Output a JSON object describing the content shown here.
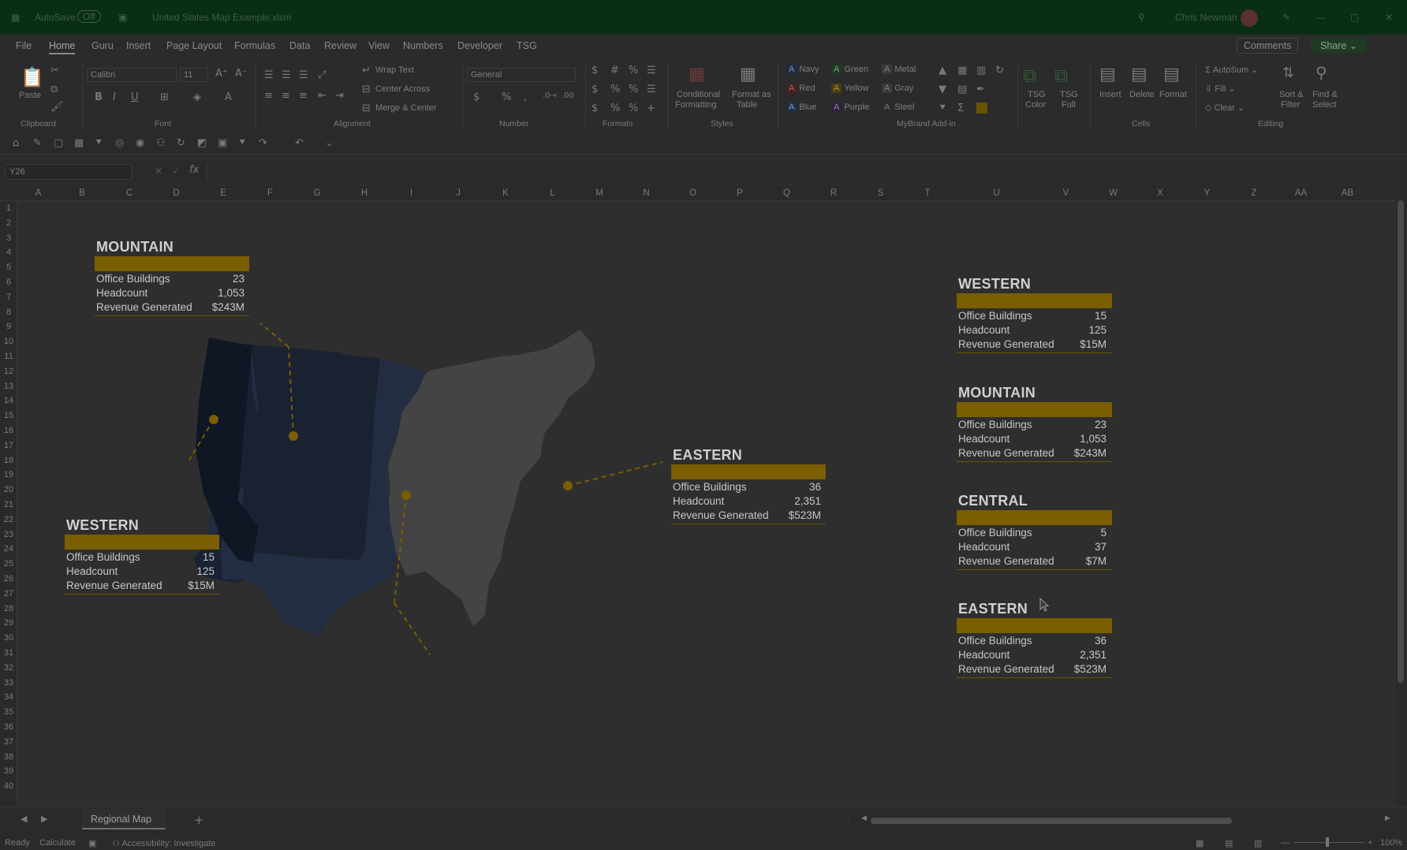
{
  "titlebar": {
    "autosave": "AutoSave",
    "autosave_state": "Off",
    "doc_title": "United States Map Example.xlsm",
    "user": "Chris Newman"
  },
  "menu": [
    "File",
    "Home",
    "Guru",
    "Insert",
    "Page Layout",
    "Formulas",
    "Data",
    "Review",
    "View",
    "Numbers",
    "Developer",
    "TSG"
  ],
  "menu_right": {
    "comments": "Comments",
    "share": "Share"
  },
  "ribbon": {
    "clipboard": {
      "paste": "Paste",
      "group": "Clipboard"
    },
    "font": {
      "name": "Calibri",
      "size": "11",
      "group": "Font"
    },
    "alignment": {
      "wrap": "Wrap Text",
      "center_across": "Center Across",
      "merge": "Merge & Center",
      "group": "Alignment"
    },
    "number": {
      "format": "General",
      "group": "Number"
    },
    "formats": {
      "group": "Formats"
    },
    "styles": {
      "cond": "Conditional",
      "cond2": "Formatting",
      "table": "Format as",
      "table2": "Table",
      "group": "Styles"
    },
    "mybrand": {
      "navy": "Navy",
      "green": "Green",
      "metal": "Metal",
      "red": "Red",
      "yellow": "Yellow",
      "gray": "Gray",
      "blue": "Blue",
      "purple": "Purple",
      "steel": "Steel",
      "group": "MyBrand Add-in"
    },
    "tsg": {
      "color": "TSG",
      "color2": "Color",
      "full": "TSG",
      "full2": "Full"
    },
    "cells": {
      "insert": "Insert",
      "delete": "Delete",
      "format": "Format",
      "group": "Cells"
    },
    "editing": {
      "autosum": "AutoSum",
      "fill": "Fill",
      "clear": "Clear",
      "sort": "Sort &",
      "sort2": "Filter",
      "find": "Find &",
      "find2": "Select",
      "group": "Editing"
    }
  },
  "namebox": "Y26",
  "columns": [
    "A",
    "B",
    "C",
    "D",
    "E",
    "F",
    "G",
    "H",
    "I",
    "J",
    "K",
    "L",
    "M",
    "N",
    "O",
    "P",
    "Q",
    "R",
    "S",
    "T",
    "U",
    "V",
    "W",
    "X",
    "Y",
    "Z",
    "AA",
    "AB"
  ],
  "rows": [
    "1",
    "2",
    "3",
    "4",
    "5",
    "6",
    "7",
    "8",
    "9",
    "10",
    "11",
    "12",
    "13",
    "14",
    "15",
    "16",
    "17",
    "18",
    "19",
    "20",
    "21",
    "22",
    "23",
    "24",
    "25",
    "26",
    "27",
    "28",
    "29",
    "30",
    "31",
    "32",
    "33",
    "34",
    "35",
    "36",
    "37",
    "38",
    "39",
    "40"
  ],
  "labels": {
    "buildings": "Office Buildings",
    "headcount": "Headcount",
    "revenue": "Revenue Generated"
  },
  "map_cards": {
    "mountain": {
      "title": "MOUNTAIN",
      "buildings": "23",
      "headcount": "1,053",
      "revenue": "$243M"
    },
    "western": {
      "title": "WESTERN",
      "buildings": "15",
      "headcount": "125",
      "revenue": "$15M"
    },
    "eastern": {
      "title": "EASTERN",
      "buildings": "36",
      "headcount": "2,351",
      "revenue": "$523M"
    }
  },
  "side_cards": [
    {
      "title": "WESTERN",
      "buildings": "15",
      "headcount": "125",
      "revenue": "$15M"
    },
    {
      "title": "MOUNTAIN",
      "buildings": "23",
      "headcount": "1,053",
      "revenue": "$243M"
    },
    {
      "title": "CENTRAL",
      "buildings": "5",
      "headcount": "37",
      "revenue": "$7M"
    },
    {
      "title": "EASTERN",
      "buildings": "36",
      "headcount": "2,351",
      "revenue": "$523M"
    }
  ],
  "sheet_tab": "Regional Map",
  "status": {
    "ready": "Ready",
    "calculate": "Calculate",
    "accessibility": "Accessibility: Investigate",
    "zoom": "100%"
  },
  "colors": {
    "accent": "#7a5e00",
    "region_west": "#0f1724",
    "region_mountain": "#1a2232",
    "region_central": "#222d42",
    "region_east": "#444444"
  }
}
